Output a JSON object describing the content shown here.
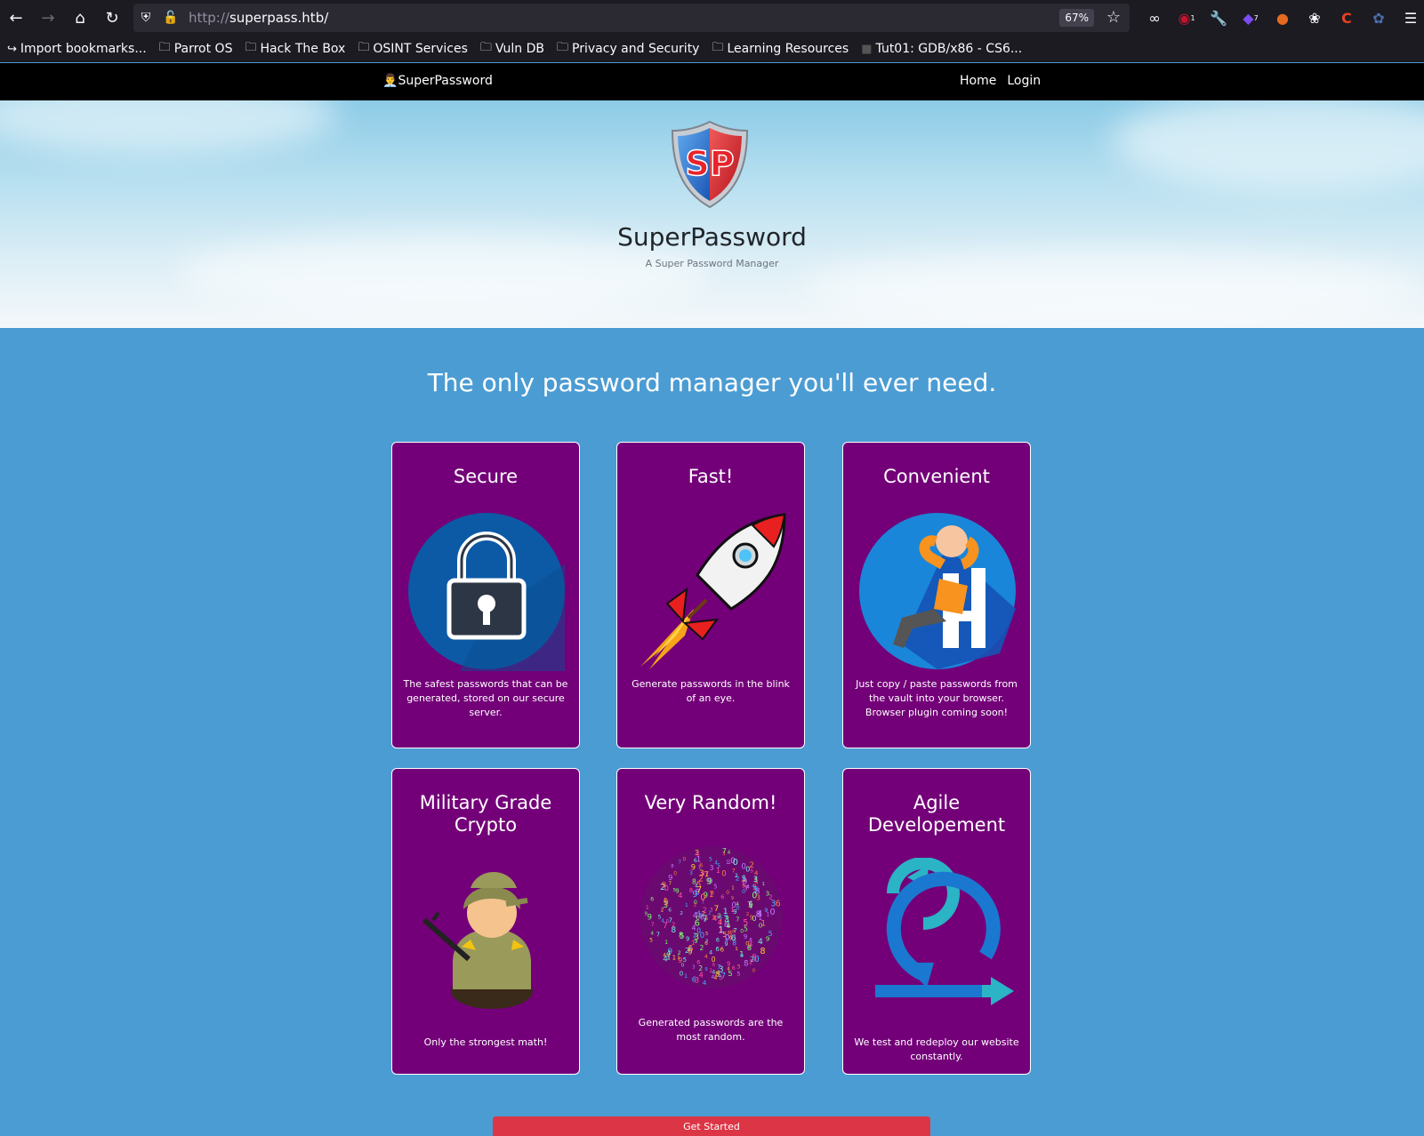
{
  "browser": {
    "url_protocol": "http://",
    "url_host": "superpass.htb/",
    "zoom": "67%",
    "bookmarks": [
      {
        "label": "Import bookmarks...",
        "icon": "import-icon"
      },
      {
        "label": "Parrot OS",
        "icon": "folder-icon"
      },
      {
        "label": "Hack The Box",
        "icon": "folder-icon"
      },
      {
        "label": "OSINT Services",
        "icon": "folder-icon"
      },
      {
        "label": "Vuln DB",
        "icon": "folder-icon"
      },
      {
        "label": "Privacy and Security",
        "icon": "folder-icon"
      },
      {
        "label": "Learning Resources",
        "icon": "folder-icon"
      },
      {
        "label": "Tut01: GDB/x86 - CS6...",
        "icon": "page-icon"
      }
    ],
    "ext_badges": [
      "1",
      "7"
    ]
  },
  "site": {
    "brand": "SuperPassword",
    "brand_icon": "👨‍💼",
    "nav": {
      "home": "Home",
      "login": "Login"
    },
    "hero": {
      "title": "SuperPassword",
      "subtitle": "A Super Password Manager",
      "logo_text": "SP"
    },
    "tagline": "The only password manager you'll ever need.",
    "cards": [
      {
        "title": "Secure",
        "text": "The safest passwords that can be generated, stored on our secure server.",
        "icon": "padlock-icon"
      },
      {
        "title": "Fast!",
        "text": "Generate passwords in the blink of an eye.",
        "icon": "rocket-icon"
      },
      {
        "title": "Convenient",
        "text": "Just copy / paste passwords from the vault into your browser. Browser plugin coming soon!",
        "icon": "relaxing-person-icon"
      },
      {
        "title": "Military Grade Crypto",
        "text": "Only the strongest math!",
        "icon": "soldier-icon"
      },
      {
        "title": "Very Random!",
        "text": "Generated passwords are the most random.",
        "icon": "random-numbers-icon"
      },
      {
        "title": "Agile Developement",
        "text": "We test and redeploy our website constantly.",
        "icon": "agile-cycle-icon"
      }
    ],
    "cta": "Get Started"
  },
  "colors": {
    "card_bg": "#730078",
    "page_bg": "#4b9cd3",
    "cta": "#dc3545"
  }
}
